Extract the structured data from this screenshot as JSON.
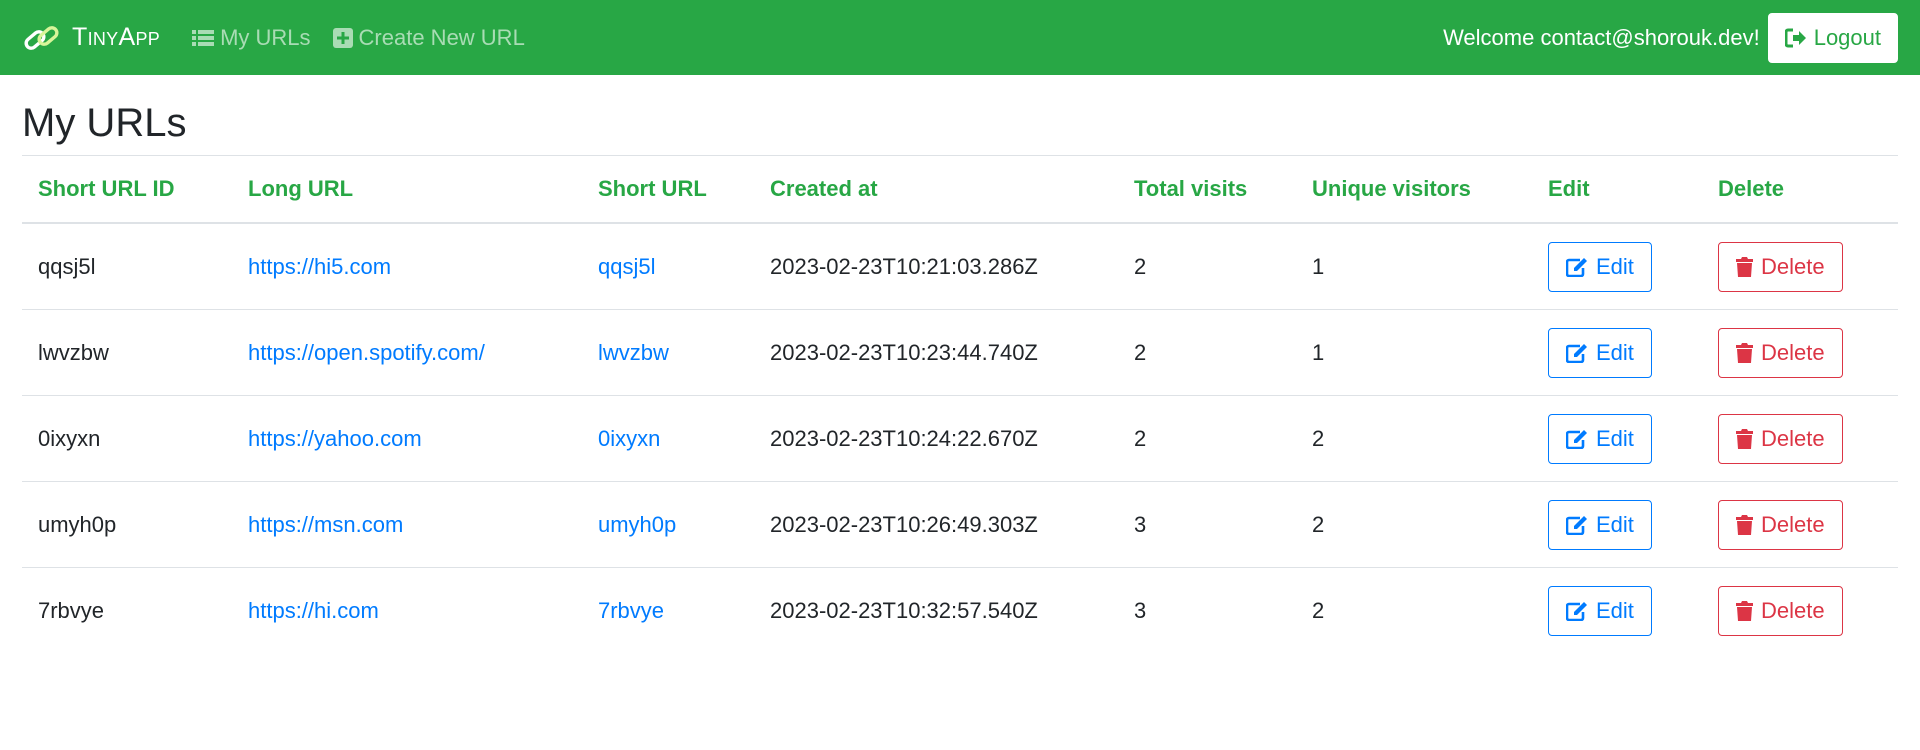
{
  "navbar": {
    "brand": "TinyApp",
    "links": [
      {
        "label": "My URLs",
        "icon": "list-icon"
      },
      {
        "label": "Create New URL",
        "icon": "plus-square-icon"
      }
    ],
    "welcome": "Welcome contact@shorouk.dev!",
    "logout_label": "Logout"
  },
  "page": {
    "title": "My URLs"
  },
  "table": {
    "headers": [
      "Short URL ID",
      "Long URL",
      "Short URL",
      "Created at",
      "Total visits",
      "Unique visitors",
      "Edit",
      "Delete"
    ],
    "rows": [
      {
        "id": "qqsj5l",
        "long_url": "https://hi5.com",
        "short_url": "qqsj5l",
        "created_at": "2023-02-23T10:21:03.286Z",
        "total_visits": "2",
        "unique_visitors": "1",
        "edit_label": "Edit",
        "delete_label": "Delete"
      },
      {
        "id": "lwvzbw",
        "long_url": "https://open.spotify.com/",
        "short_url": "lwvzbw",
        "created_at": "2023-02-23T10:23:44.740Z",
        "total_visits": "2",
        "unique_visitors": "1",
        "edit_label": "Edit",
        "delete_label": "Delete"
      },
      {
        "id": "0ixyxn",
        "long_url": "https://yahoo.com",
        "short_url": "0ixyxn",
        "created_at": "2023-02-23T10:24:22.670Z",
        "total_visits": "2",
        "unique_visitors": "2",
        "edit_label": "Edit",
        "delete_label": "Delete"
      },
      {
        "id": "umyh0p",
        "long_url": "https://msn.com",
        "short_url": "umyh0p",
        "created_at": "2023-02-23T10:26:49.303Z",
        "total_visits": "3",
        "unique_visitors": "2",
        "edit_label": "Edit",
        "delete_label": "Delete"
      },
      {
        "id": "7rbvye",
        "long_url": "https://hi.com",
        "short_url": "7rbvye",
        "created_at": "2023-02-23T10:32:57.540Z",
        "total_visits": "3",
        "unique_visitors": "2",
        "edit_label": "Edit",
        "delete_label": "Delete"
      }
    ]
  },
  "colors": {
    "brand": "#28a745",
    "link": "#007bff",
    "danger": "#dc3545"
  }
}
